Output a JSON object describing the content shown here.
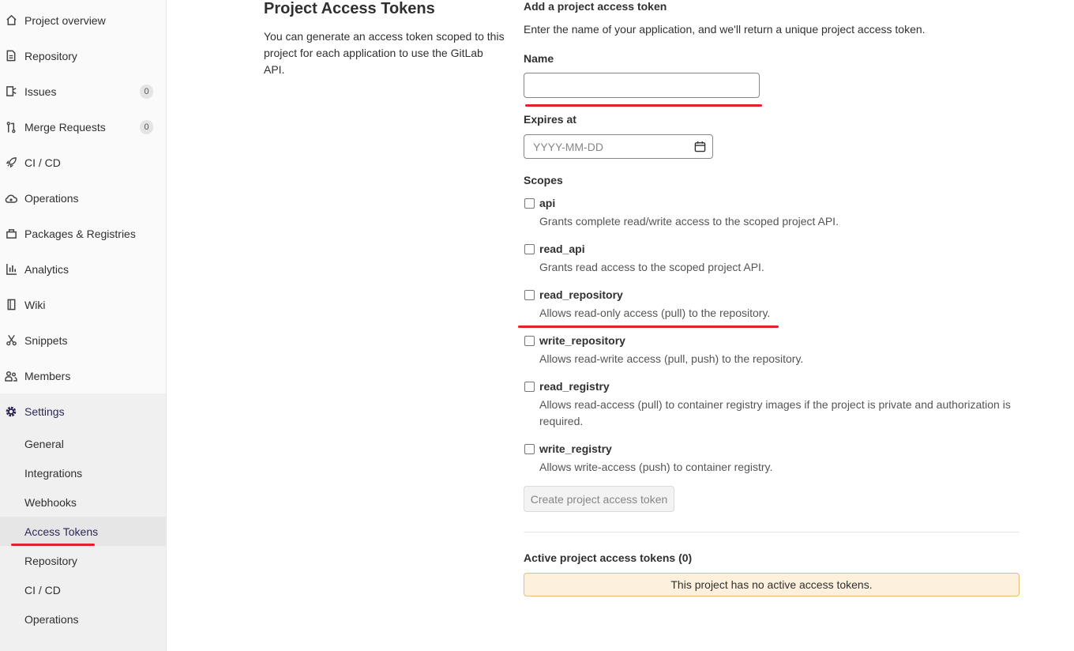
{
  "sidebar": {
    "items": [
      {
        "label": "Project overview",
        "icon": "home-icon"
      },
      {
        "label": "Repository",
        "icon": "document-icon"
      },
      {
        "label": "Issues",
        "icon": "issues-icon",
        "count": "0"
      },
      {
        "label": "Merge Requests",
        "icon": "merge-request-icon",
        "count": "0"
      },
      {
        "label": "CI / CD",
        "icon": "rocket-icon"
      },
      {
        "label": "Operations",
        "icon": "cloud-gear-icon"
      },
      {
        "label": "Packages & Registries",
        "icon": "package-icon"
      },
      {
        "label": "Analytics",
        "icon": "chart-icon"
      },
      {
        "label": "Wiki",
        "icon": "book-icon"
      },
      {
        "label": "Snippets",
        "icon": "scissors-icon"
      },
      {
        "label": "Members",
        "icon": "users-icon"
      }
    ],
    "settings": {
      "label": "Settings",
      "icon": "gear-icon"
    },
    "settings_sub": [
      {
        "label": "General"
      },
      {
        "label": "Integrations"
      },
      {
        "label": "Webhooks"
      },
      {
        "label": "Access Tokens"
      },
      {
        "label": "Repository"
      },
      {
        "label": "CI / CD"
      },
      {
        "label": "Operations"
      }
    ]
  },
  "main": {
    "title": "Project Access Tokens",
    "description": "You can generate an access token scoped to this project for each application to use the GitLab API.",
    "form": {
      "heading": "Add a project access token",
      "intro": "Enter the name of your application, and we'll return a unique project access token.",
      "name_label": "Name",
      "name_value": "",
      "expires_label": "Expires at",
      "expires_placeholder": "YYYY-MM-DD",
      "scopes_label": "Scopes",
      "scopes": [
        {
          "name": "api",
          "desc": "Grants complete read/write access to the scoped project API."
        },
        {
          "name": "read_api",
          "desc": "Grants read access to the scoped project API."
        },
        {
          "name": "read_repository",
          "desc": "Allows read-only access (pull) to the repository."
        },
        {
          "name": "write_repository",
          "desc": "Allows read-write access (pull, push) to the repository."
        },
        {
          "name": "read_registry",
          "desc": "Allows read-access (pull) to container registry images if the project is private and authorization is required."
        },
        {
          "name": "write_registry",
          "desc": "Allows write-access (push) to container registry."
        }
      ],
      "submit_label": "Create project access token"
    },
    "active_heading": "Active project access tokens (0)",
    "empty_message": "This project has no active access tokens."
  },
  "colors": {
    "annotation_red": "#e3212b",
    "accent": "#2b2856"
  }
}
